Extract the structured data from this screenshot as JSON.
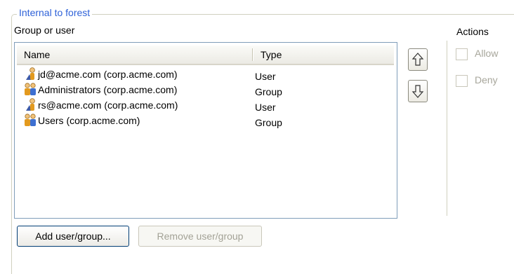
{
  "section": {
    "legend": "Internal to forest",
    "group_or_user_label": "Group or user"
  },
  "list": {
    "columns": {
      "name": "Name",
      "type": "Type"
    },
    "rows": [
      {
        "name": "jd@acme.com (corp.acme.com)",
        "type": "User",
        "icon": "user-icon"
      },
      {
        "name": "Administrators (corp.acme.com)",
        "type": "Group",
        "icon": "group-icon"
      },
      {
        "name": "rs@acme.com (corp.acme.com)",
        "type": "User",
        "icon": "user-icon"
      },
      {
        "name": "Users (corp.acme.com)",
        "type": "Group",
        "icon": "group-icon"
      }
    ]
  },
  "actions": {
    "label": "Actions",
    "allow": {
      "label": "Allow",
      "checked": false
    },
    "deny": {
      "label": "Deny",
      "checked": false
    }
  },
  "buttons": {
    "add_label": "Add user/group...",
    "remove_label": "Remove user/group",
    "move_up_icon": "arrow-up-icon",
    "move_down_icon": "arrow-down-icon"
  },
  "colors": {
    "accent": "#2f62d8",
    "border": "#7f9db9",
    "disabled_text": "#a7a69b"
  }
}
